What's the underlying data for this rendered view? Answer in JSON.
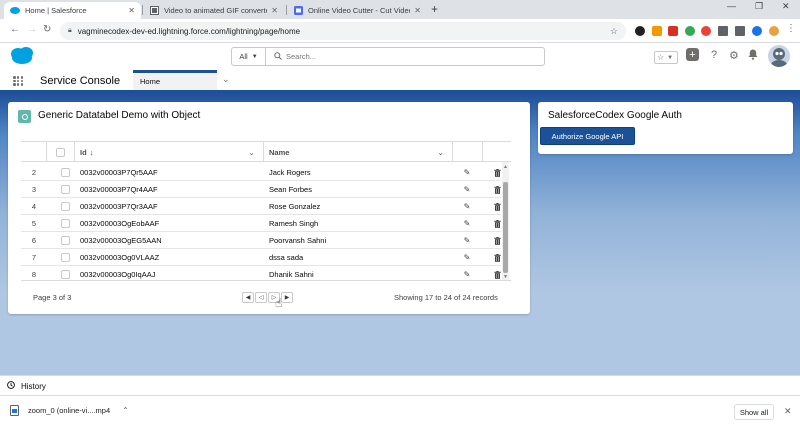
{
  "browser": {
    "tabs": [
      {
        "title": "Home | Salesforce",
        "icon": "salesforce-icon",
        "active": true
      },
      {
        "title": "Video to animated GIF converter",
        "icon": "gif-converter-icon",
        "active": false
      },
      {
        "title": "Online Video Cutter - Cut Video",
        "icon": "video-cutter-icon",
        "active": false
      }
    ],
    "url": "vagminecodex-dev-ed.lightning.force.com/lightning/page/home"
  },
  "sf_header": {
    "search_scope": "All",
    "search_placeholder": "Search..."
  },
  "app_nav": {
    "app_name": "Service Console",
    "tab_label": "Home"
  },
  "datatable_card": {
    "title": "Generic Datatabel Demo with Object",
    "columns": [
      "Id",
      "Name"
    ],
    "sort_indicator": "↓",
    "rows": [
      {
        "num": "2",
        "id": "0032v00003P7Qr5AAF",
        "name": "Jack Rogers"
      },
      {
        "num": "3",
        "id": "0032v00003P7Qr4AAF",
        "name": "Sean Forbes"
      },
      {
        "num": "4",
        "id": "0032v00003P7Qr3AAF",
        "name": "Rose Gonzalez"
      },
      {
        "num": "5",
        "id": "0032v00003OgEobAAF",
        "name": "Ramesh Singh"
      },
      {
        "num": "6",
        "id": "0032v00003OgEG5AAN",
        "name": "Poorvansh Sahni"
      },
      {
        "num": "7",
        "id": "0032v00003Og0VLAAZ",
        "name": "dssa sada"
      },
      {
        "num": "8",
        "id": "0032v00003Og0IqAAJ",
        "name": "Dhanik Sahni"
      }
    ],
    "page_info": "Page 3 of 3",
    "showing": "Showing 17 to 24 of 24 records"
  },
  "auth_card": {
    "title": "SalesforceCodex Google Auth",
    "button_label": "Authorize Google API"
  },
  "utility_bar": {
    "history_label": "History"
  },
  "download_bar": {
    "file_name": "zoom_0 (online-vi....mp4",
    "show_all_label": "Show all"
  },
  "colors": {
    "brand_blue": "#1b5297",
    "salesforce_cloud": "#00a1e0",
    "card_icon_teal": "#62b7ad"
  }
}
